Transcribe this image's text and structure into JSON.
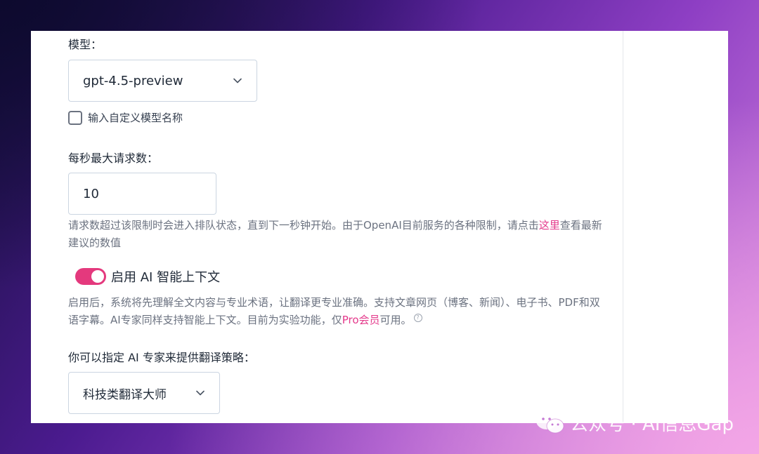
{
  "model": {
    "label": "模型：",
    "selected": "gpt-4.5-preview",
    "custom_checkbox_label": "输入自定义模型名称"
  },
  "rate_limit": {
    "label": "每秒最大请求数：",
    "value": "10",
    "help_before": "请求数超过该限制时会进入排队状态，直到下一秒钟开始。由于OpenAI目前服务的各种限制，请点击",
    "help_link": "这里",
    "help_after": "查看最新建议的数值"
  },
  "ai_context": {
    "enabled": true,
    "label": "启用 AI 智能上下文",
    "help_before": "启用后，系统将先理解全文内容与专业术语，让翻译更专业准确。支持文章网页（博客、新闻）、电子书、PDF和双语字幕。AI专家同样支持智能上下文。目前为实验功能，仅",
    "help_link": "Pro会员",
    "help_after": "可用。",
    "help_icon": "?"
  },
  "expert": {
    "label": "你可以指定 AI 专家来提供翻译策略：",
    "selected": "科技类翻译大师"
  },
  "watermark": {
    "text": "公众号 · AI信息Gap"
  },
  "colors": {
    "accent": "#e4397d",
    "link": "#e4398b"
  }
}
